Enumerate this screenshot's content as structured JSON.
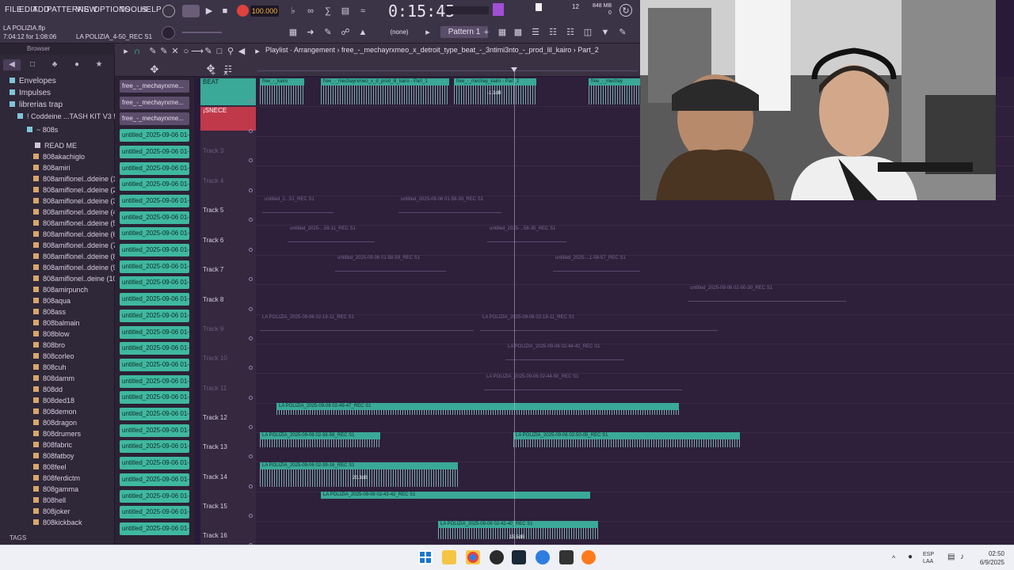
{
  "menu": [
    "FILE",
    "EDIT",
    "ADD",
    "PATTERNS",
    "VIEW",
    "OPTIONS",
    "TOOLS",
    "HELP"
  ],
  "transport": {
    "tempo": "100.000",
    "clock": "0:15:45",
    "pattern": "Pattern 1",
    "none_label": "(none)",
    "mem_top": "12",
    "mem_mb": "848 MB",
    "mem_bottom": "0"
  },
  "project": {
    "name": "LA POLIZIA.flp",
    "time": "7:04:12 for 1:08:06",
    "hint": "LA POLIZIA_4-50_REC S1"
  },
  "browser": {
    "header": "Browser",
    "folders": [
      "Envelopes",
      "Impulses",
      "librerias trap",
      "! Coddeine ...TASH KIT V3 !",
      "~ 808s"
    ],
    "files": [
      "READ ME",
      "808akachiglo",
      "808amiri",
      "808amiflonel..ddeine (1)",
      "808amiflonel..ddeine (2)",
      "808amiflonel..ddeine (3)",
      "808amiflonel..ddeine (4)",
      "808amiflonel..ddeine (5)",
      "808amiflonel..ddeine (6)",
      "808amiflonel..ddeine (7)",
      "808amiflonel..ddeine (8)",
      "808amiflonel..ddeine (9)",
      "808amiflonel..deine (10)",
      "808amirpunch",
      "808aqua",
      "808ass",
      "808balmain",
      "808blow",
      "808bro",
      "808corleo",
      "808cuh",
      "808damm",
      "808dd",
      "808ded18",
      "808demon",
      "808dragon",
      "808drumers",
      "808fabric",
      "808fatboy",
      "808feel",
      "808ferdictm",
      "808gamma",
      "808hell",
      "808joker",
      "808kickback"
    ],
    "tags_label": "TAGS"
  },
  "channels": {
    "purple": [
      "free_-_mechayrxme...",
      "free_-_mechayrxme...",
      "free_-_mechayrxme..."
    ],
    "teal_label": "untitled_2025-09-06 01-..."
  },
  "playlist": {
    "title": "Playlist · Arrangement › free_-_mechayrxmeo_x_detroit_type_beat_-_3ntimi3nto_-_prod_lil_kairo › Part_2"
  },
  "tracks": [
    {
      "name": "BEAT",
      "style": "beat"
    },
    {
      "name": "¡SNECE",
      "style": "snece"
    },
    {
      "name": "Track 3",
      "style": "dim"
    },
    {
      "name": "Track 4",
      "style": "dim"
    },
    {
      "name": "Track 5",
      "style": "normal"
    },
    {
      "name": "Track 6",
      "style": "normal"
    },
    {
      "name": "Track 7",
      "style": "normal"
    },
    {
      "name": "Track 8",
      "style": "normal"
    },
    {
      "name": "Track 9",
      "style": "dim"
    },
    {
      "name": "Track 10",
      "style": "dim"
    },
    {
      "name": "Track 11",
      "style": "dim"
    },
    {
      "name": "Track 12",
      "style": "normal"
    },
    {
      "name": "Track 13",
      "style": "normal"
    },
    {
      "name": "Track 14",
      "style": "normal"
    },
    {
      "name": "Track 15",
      "style": "normal"
    },
    {
      "name": "Track 16",
      "style": "normal"
    }
  ],
  "clips": {
    "beat": [
      "free_-_kairo",
      "free_-_mechayrxmeo_x_d_prod_lil_kairo - Part_1",
      "free_-_mechay_kairo - Part_2",
      "free_-_mechay"
    ],
    "beat_db": "-1.1dB",
    "t5": [
      "untitled_2...51_REC S1",
      "untitled_2025-09-06 01-58-30_REC S1"
    ],
    "t6": [
      "untitled_2025-...58-11_REC S1",
      "untitled_2025-...58-35_REC S1"
    ],
    "t7": [
      "untitled_2025-09-06 01-58-59_REC S1",
      "untitled_2025-...1-58-57_REC S1"
    ],
    "t8": [
      "untitled_2025-09-06 02-00-30_REC S1"
    ],
    "t9": [
      "LA POLIZIA_2025-09-06 02-19-11_REC S1",
      "LA POLIZIA_2025-09-06 02-19-11_REC S1"
    ],
    "t10": [
      "LA POLIZIA_2025-09-06 02-44-42_REC S1"
    ],
    "t11": [
      "LA POLIZIA_2025-09-06 02-44-50_REC S1"
    ],
    "t12": [
      "LA POLIZIA_2025-09-06 02-49-47_REC S1"
    ],
    "t13": [
      "LA POLIZIA_2025-09-06 02-38-58_REC S1",
      "LA POLIZIA_2025-09-06 02-50-05_REC S1"
    ],
    "t14": [
      "LA POLIZIA_2025-09-06 02-39-16_REC S1"
    ],
    "t14_db": "20.3dB",
    "t15": [
      "LA POLIZIA_2025-09-06 02-43-42_REC S1"
    ],
    "t16": [
      "LA POLIZIA_2025-09-06 02-42-40_REC S1"
    ],
    "t16_db": "15.5dB"
  },
  "taskbar": {
    "lang_top": "ESP",
    "lang_bottom": "LAA",
    "time": "02:50",
    "date": "6/9/2025"
  },
  "colors": {
    "accent_teal": "#3fb8a0",
    "record_red": "#e0423f",
    "tempo_orange": "#f4b43b",
    "bg_purple": "#2e1f3b"
  }
}
